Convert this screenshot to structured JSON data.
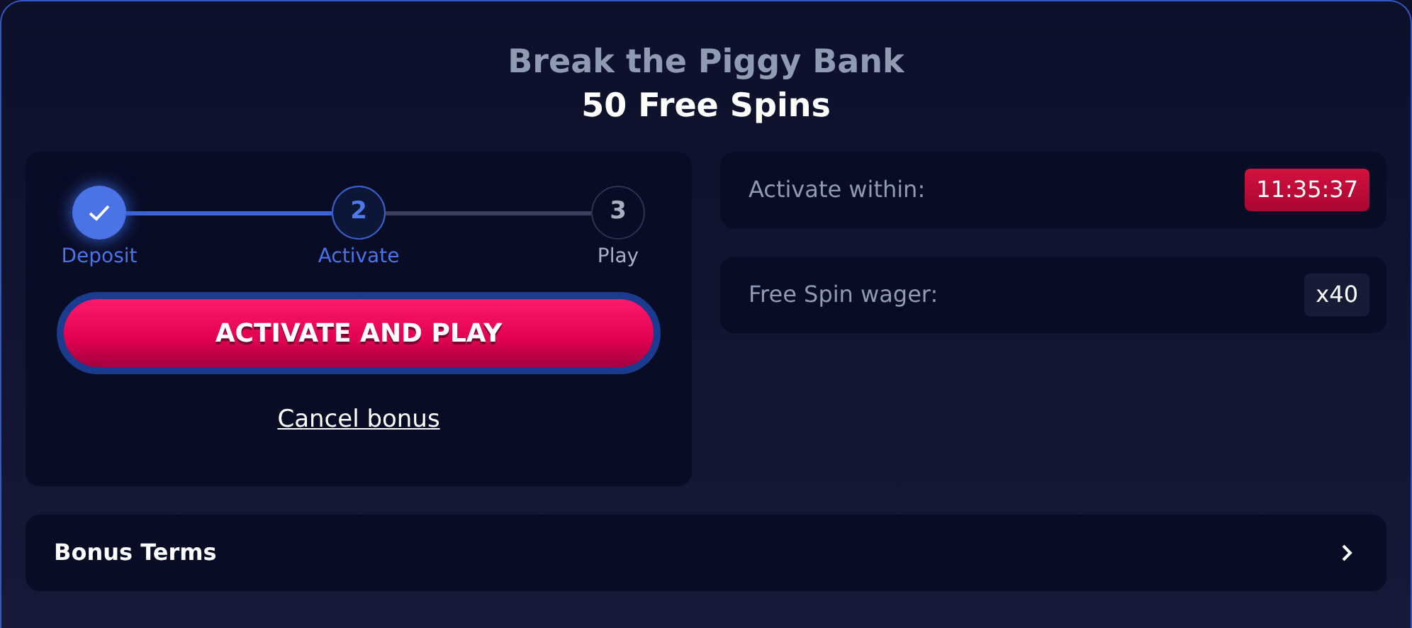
{
  "header": {
    "title": "Break the Piggy Bank",
    "subtitle": "50 Free Spins"
  },
  "steps": [
    {
      "label": "Deposit",
      "completed": true,
      "selected": false
    },
    {
      "number": "2",
      "label": "Activate",
      "completed": false,
      "selected": true
    },
    {
      "number": "3",
      "label": "Play",
      "completed": false,
      "selected": false
    }
  ],
  "primary_button": "ACTIVATE AND PLAY",
  "cancel_link": "Cancel bonus",
  "info_rows": [
    {
      "label": "Activate within:",
      "value": "11:35:37",
      "kind": "timer"
    },
    {
      "label": "Free Spin wager:",
      "value": "x40",
      "kind": "plain"
    }
  ],
  "terms": {
    "label": "Bonus Terms",
    "expanded": false
  }
}
